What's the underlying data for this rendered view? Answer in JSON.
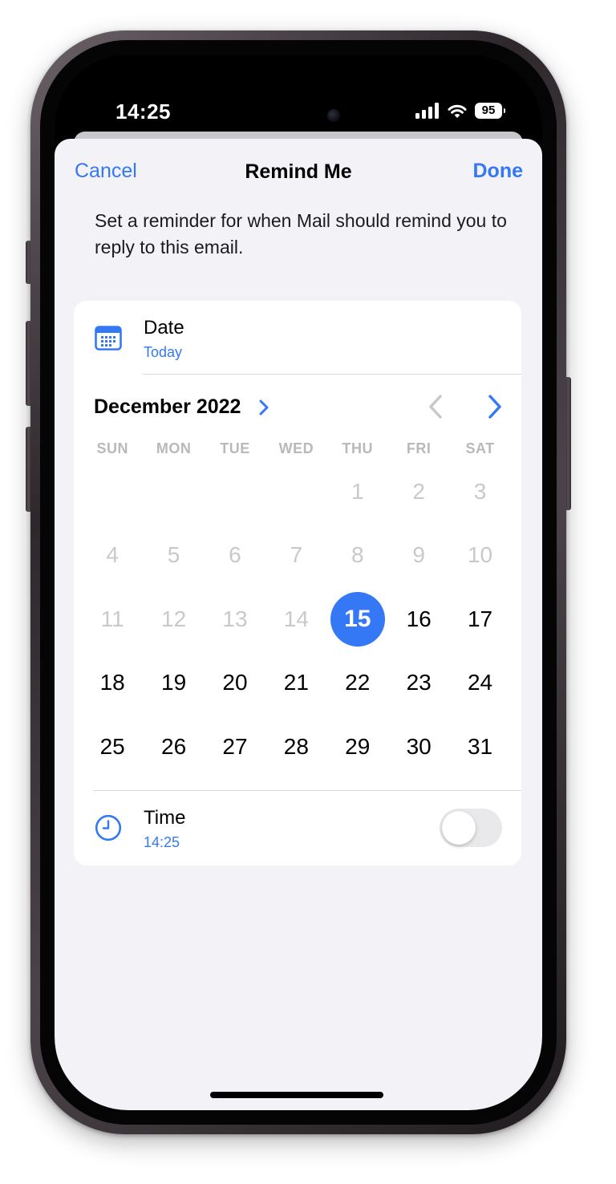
{
  "status_bar": {
    "time": "14:25",
    "battery": "95",
    "icons": [
      "cellular-signal-icon",
      "wifi-icon",
      "battery-icon"
    ]
  },
  "nav": {
    "cancel_label": "Cancel",
    "title": "Remind Me",
    "done_label": "Done"
  },
  "description": "Set a reminder for when Mail should remind you to reply to this email.",
  "date_row": {
    "icon": "calendar-icon",
    "label": "Date",
    "value": "Today"
  },
  "calendar": {
    "month_label": "December 2022",
    "weekdays": [
      "SUN",
      "MON",
      "TUE",
      "WED",
      "THU",
      "FRI",
      "SAT"
    ],
    "first_weekday_index": 4,
    "days_in_month": 31,
    "selected_day": 15
  },
  "time_row": {
    "icon": "clock-icon",
    "label": "Time",
    "value": "14:25",
    "toggle_on": false
  },
  "colors": {
    "accent": "#3478f6",
    "sheet_background": "#f2f2f7",
    "disabled_text": "#c9c9cd",
    "weekday_text": "#b9b9bd"
  }
}
